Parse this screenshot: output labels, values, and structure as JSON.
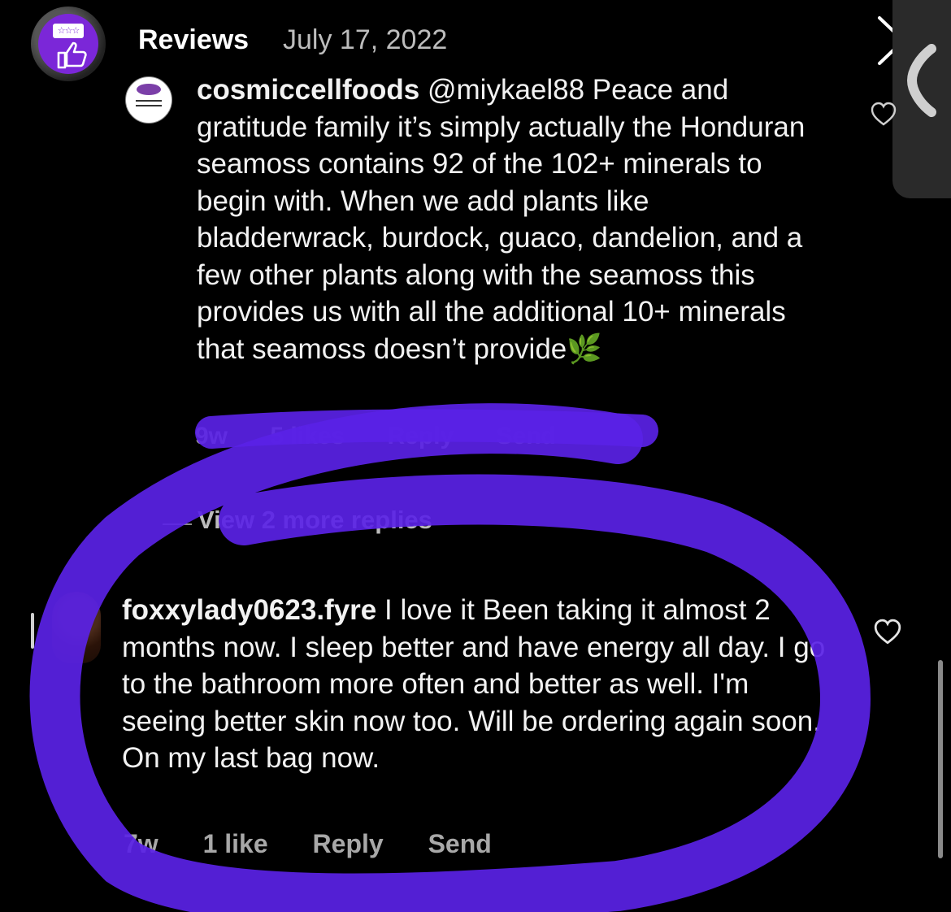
{
  "header": {
    "account_title": "Reviews",
    "date": "July 17, 2022",
    "avatar_icon": "reviews-thumbs-up-icon",
    "close_icon": "close-icon"
  },
  "side_tab": {
    "icon": "chevron-left-icon"
  },
  "comments": [
    {
      "username": "cosmiccellfoods",
      "text": " @miykael88 Peace and gratitude family it’s simply actually the Honduran seamoss contains 92 of the 102+ minerals to begin with. When we add plants like bladderwrack, burdock, guaco, dandelion, and a few other plants along with the seamoss this provides us with all the additional 10+ minerals that seamoss doesn’t provide",
      "emoji": "🌿",
      "time": "9w",
      "likes": "5 likes",
      "reply": "Reply",
      "send": "Send"
    },
    {
      "username": "foxxylady0623.fyre",
      "text": " I love it Been taking it almost 2 months now. I sleep better and have energy all day. I go to the bathroom more often and better as well. I'm seeing better skin now too. Will be ordering again soon. On my last bag now.",
      "time": "7w",
      "likes": "1 like",
      "reply": "Reply",
      "send": "Send"
    }
  ],
  "view_more_replies": "View 2 more replies",
  "colors": {
    "highlight": "#5a22e6",
    "brand_purple": "#7b27d8"
  }
}
